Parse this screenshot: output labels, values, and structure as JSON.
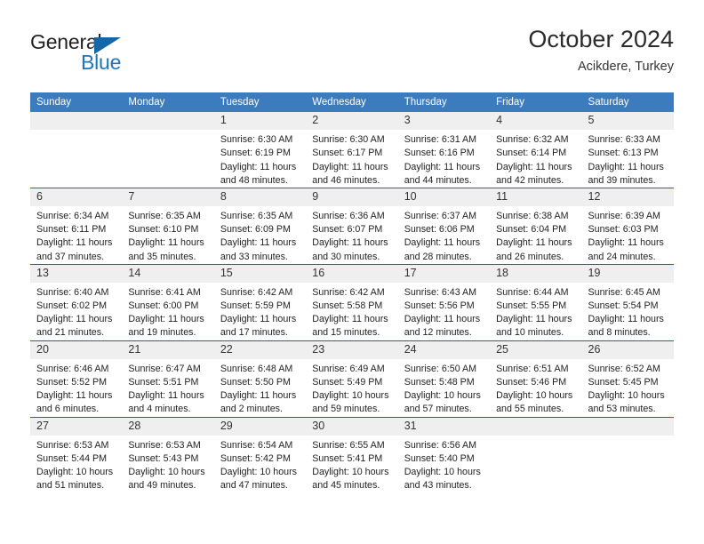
{
  "brand": {
    "name_part1": "General",
    "name_part2": "Blue",
    "triangle_color": "#1566a8",
    "blue_color": "#1b75bc"
  },
  "header": {
    "title": "October 2024",
    "subtitle": "Acikdere, Turkey"
  },
  "theme": {
    "header_row_bg": "#3a7cbe",
    "row_divider": "#1f62a8",
    "daynum_bg": "#efefef",
    "page_bg": "#ffffff"
  },
  "weekdays": [
    "Sunday",
    "Monday",
    "Tuesday",
    "Wednesday",
    "Thursday",
    "Friday",
    "Saturday"
  ],
  "labels": {
    "sunrise_prefix": "Sunrise: ",
    "sunset_prefix": "Sunset: ",
    "daylight_prefix": "Daylight: "
  },
  "weeks": [
    [
      {
        "day": "",
        "sunrise": "",
        "sunset": "",
        "daylight": ""
      },
      {
        "day": "",
        "sunrise": "",
        "sunset": "",
        "daylight": ""
      },
      {
        "day": "1",
        "sunrise": "Sunrise: 6:30 AM",
        "sunset": "Sunset: 6:19 PM",
        "daylight": "Daylight: 11 hours and 48 minutes."
      },
      {
        "day": "2",
        "sunrise": "Sunrise: 6:30 AM",
        "sunset": "Sunset: 6:17 PM",
        "daylight": "Daylight: 11 hours and 46 minutes."
      },
      {
        "day": "3",
        "sunrise": "Sunrise: 6:31 AM",
        "sunset": "Sunset: 6:16 PM",
        "daylight": "Daylight: 11 hours and 44 minutes."
      },
      {
        "day": "4",
        "sunrise": "Sunrise: 6:32 AM",
        "sunset": "Sunset: 6:14 PM",
        "daylight": "Daylight: 11 hours and 42 minutes."
      },
      {
        "day": "5",
        "sunrise": "Sunrise: 6:33 AM",
        "sunset": "Sunset: 6:13 PM",
        "daylight": "Daylight: 11 hours and 39 minutes."
      }
    ],
    [
      {
        "day": "6",
        "sunrise": "Sunrise: 6:34 AM",
        "sunset": "Sunset: 6:11 PM",
        "daylight": "Daylight: 11 hours and 37 minutes."
      },
      {
        "day": "7",
        "sunrise": "Sunrise: 6:35 AM",
        "sunset": "Sunset: 6:10 PM",
        "daylight": "Daylight: 11 hours and 35 minutes."
      },
      {
        "day": "8",
        "sunrise": "Sunrise: 6:35 AM",
        "sunset": "Sunset: 6:09 PM",
        "daylight": "Daylight: 11 hours and 33 minutes."
      },
      {
        "day": "9",
        "sunrise": "Sunrise: 6:36 AM",
        "sunset": "Sunset: 6:07 PM",
        "daylight": "Daylight: 11 hours and 30 minutes."
      },
      {
        "day": "10",
        "sunrise": "Sunrise: 6:37 AM",
        "sunset": "Sunset: 6:06 PM",
        "daylight": "Daylight: 11 hours and 28 minutes."
      },
      {
        "day": "11",
        "sunrise": "Sunrise: 6:38 AM",
        "sunset": "Sunset: 6:04 PM",
        "daylight": "Daylight: 11 hours and 26 minutes."
      },
      {
        "day": "12",
        "sunrise": "Sunrise: 6:39 AM",
        "sunset": "Sunset: 6:03 PM",
        "daylight": "Daylight: 11 hours and 24 minutes."
      }
    ],
    [
      {
        "day": "13",
        "sunrise": "Sunrise: 6:40 AM",
        "sunset": "Sunset: 6:02 PM",
        "daylight": "Daylight: 11 hours and 21 minutes."
      },
      {
        "day": "14",
        "sunrise": "Sunrise: 6:41 AM",
        "sunset": "Sunset: 6:00 PM",
        "daylight": "Daylight: 11 hours and 19 minutes."
      },
      {
        "day": "15",
        "sunrise": "Sunrise: 6:42 AM",
        "sunset": "Sunset: 5:59 PM",
        "daylight": "Daylight: 11 hours and 17 minutes."
      },
      {
        "day": "16",
        "sunrise": "Sunrise: 6:42 AM",
        "sunset": "Sunset: 5:58 PM",
        "daylight": "Daylight: 11 hours and 15 minutes."
      },
      {
        "day": "17",
        "sunrise": "Sunrise: 6:43 AM",
        "sunset": "Sunset: 5:56 PM",
        "daylight": "Daylight: 11 hours and 12 minutes."
      },
      {
        "day": "18",
        "sunrise": "Sunrise: 6:44 AM",
        "sunset": "Sunset: 5:55 PM",
        "daylight": "Daylight: 11 hours and 10 minutes."
      },
      {
        "day": "19",
        "sunrise": "Sunrise: 6:45 AM",
        "sunset": "Sunset: 5:54 PM",
        "daylight": "Daylight: 11 hours and 8 minutes."
      }
    ],
    [
      {
        "day": "20",
        "sunrise": "Sunrise: 6:46 AM",
        "sunset": "Sunset: 5:52 PM",
        "daylight": "Daylight: 11 hours and 6 minutes."
      },
      {
        "day": "21",
        "sunrise": "Sunrise: 6:47 AM",
        "sunset": "Sunset: 5:51 PM",
        "daylight": "Daylight: 11 hours and 4 minutes."
      },
      {
        "day": "22",
        "sunrise": "Sunrise: 6:48 AM",
        "sunset": "Sunset: 5:50 PM",
        "daylight": "Daylight: 11 hours and 2 minutes."
      },
      {
        "day": "23",
        "sunrise": "Sunrise: 6:49 AM",
        "sunset": "Sunset: 5:49 PM",
        "daylight": "Daylight: 10 hours and 59 minutes."
      },
      {
        "day": "24",
        "sunrise": "Sunrise: 6:50 AM",
        "sunset": "Sunset: 5:48 PM",
        "daylight": "Daylight: 10 hours and 57 minutes."
      },
      {
        "day": "25",
        "sunrise": "Sunrise: 6:51 AM",
        "sunset": "Sunset: 5:46 PM",
        "daylight": "Daylight: 10 hours and 55 minutes."
      },
      {
        "day": "26",
        "sunrise": "Sunrise: 6:52 AM",
        "sunset": "Sunset: 5:45 PM",
        "daylight": "Daylight: 10 hours and 53 minutes."
      }
    ],
    [
      {
        "day": "27",
        "sunrise": "Sunrise: 6:53 AM",
        "sunset": "Sunset: 5:44 PM",
        "daylight": "Daylight: 10 hours and 51 minutes."
      },
      {
        "day": "28",
        "sunrise": "Sunrise: 6:53 AM",
        "sunset": "Sunset: 5:43 PM",
        "daylight": "Daylight: 10 hours and 49 minutes."
      },
      {
        "day": "29",
        "sunrise": "Sunrise: 6:54 AM",
        "sunset": "Sunset: 5:42 PM",
        "daylight": "Daylight: 10 hours and 47 minutes."
      },
      {
        "day": "30",
        "sunrise": "Sunrise: 6:55 AM",
        "sunset": "Sunset: 5:41 PM",
        "daylight": "Daylight: 10 hours and 45 minutes."
      },
      {
        "day": "31",
        "sunrise": "Sunrise: 6:56 AM",
        "sunset": "Sunset: 5:40 PM",
        "daylight": "Daylight: 10 hours and 43 minutes."
      },
      {
        "day": "",
        "sunrise": "",
        "sunset": "",
        "daylight": ""
      },
      {
        "day": "",
        "sunrise": "",
        "sunset": "",
        "daylight": ""
      }
    ]
  ]
}
